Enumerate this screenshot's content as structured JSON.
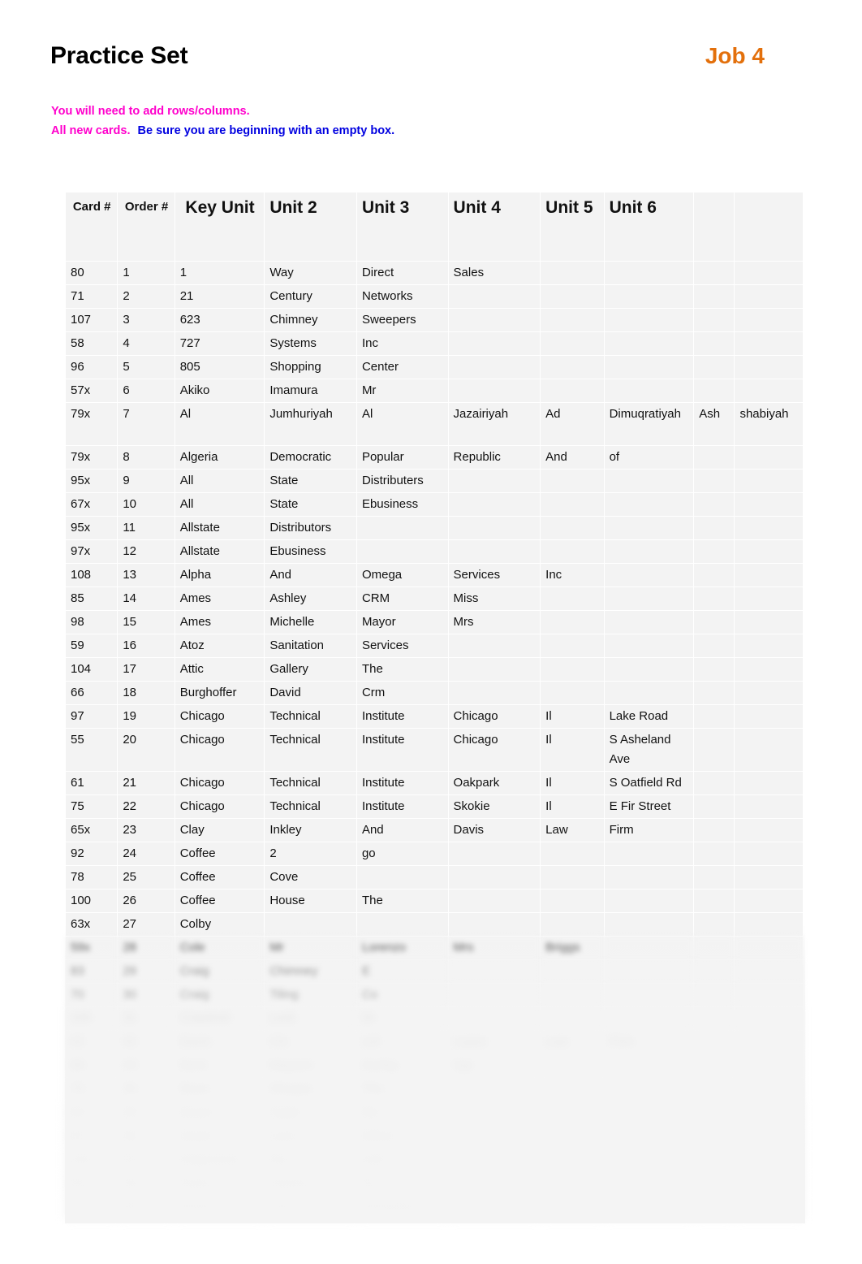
{
  "document": {
    "title": "Practice Set",
    "job_label": "Job 4"
  },
  "instructions": {
    "line1": "You will need to add rows/columns.",
    "line2_magenta": "All new cards.",
    "line2_blue": "Be sure you are beginning with an empty box."
  },
  "table": {
    "headers": [
      "Card #",
      "Order #",
      "Key Unit",
      "Unit 2",
      "Unit 3",
      "Unit 4",
      "Unit 5",
      "Unit 6",
      "",
      ""
    ],
    "rows": [
      {
        "card": "80",
        "order": "1",
        "key": "1",
        "u2": "Way",
        "u3": "Direct",
        "u4": "Sales",
        "u5": "",
        "u6": "",
        "x1": "",
        "x2": ""
      },
      {
        "card": "71",
        "order": "2",
        "key": "21",
        "u2": "Century",
        "u3": "Networks",
        "u4": "",
        "u5": "",
        "u6": "",
        "x1": "",
        "x2": ""
      },
      {
        "card": "107",
        "order": "3",
        "key": "623",
        "u2": "Chimney",
        "u3": "Sweepers",
        "u4": "",
        "u5": "",
        "u6": "",
        "x1": "",
        "x2": ""
      },
      {
        "card": "58",
        "order": "4",
        "key": "727",
        "u2": "Systems",
        "u3": "Inc",
        "u4": "",
        "u5": "",
        "u6": "",
        "x1": "",
        "x2": ""
      },
      {
        "card": "96",
        "order": "5",
        "key": "805",
        "u2": "Shopping",
        "u3": "Center",
        "u4": "",
        "u5": "",
        "u6": "",
        "x1": "",
        "x2": ""
      },
      {
        "card": "57x",
        "order": "6",
        "key": "Akiko",
        "u2": "Imamura",
        "u3": "Mr",
        "u4": "",
        "u5": "",
        "u6": "",
        "x1": "",
        "x2": ""
      },
      {
        "card": "79x",
        "order": "7",
        "key": "Al",
        "u2": "Jumhuriyah",
        "u3": "Al",
        "u4": "Jazairiyah",
        "u5": "Ad",
        "u6": "Dimuqratiyah",
        "x1": "Ash",
        "x2": "shabiyah",
        "tall": true
      },
      {
        "card": "79x",
        "order": "8",
        "key": "Algeria",
        "u2": "Democratic",
        "u3": "Popular",
        "u4": "Republic",
        "u5": "And",
        "u6": "of",
        "x1": "",
        "x2": ""
      },
      {
        "card": "95x",
        "order": "9",
        "key": "All",
        "u2": "State",
        "u3": "Distributers",
        "u4": "",
        "u5": "",
        "u6": "",
        "x1": "",
        "x2": ""
      },
      {
        "card": "67x",
        "order": "10",
        "key": "All",
        "u2": "State",
        "u3": "Ebusiness",
        "u4": "",
        "u5": "",
        "u6": "",
        "x1": "",
        "x2": ""
      },
      {
        "card": "95x",
        "order": "11",
        "key": "Allstate",
        "u2": "Distributors",
        "u3": "",
        "u4": "",
        "u5": "",
        "u6": "",
        "x1": "",
        "x2": ""
      },
      {
        "card": "97x",
        "order": "12",
        "key": "Allstate",
        "u2": "Ebusiness",
        "u3": "",
        "u4": "",
        "u5": "",
        "u6": "",
        "x1": "",
        "x2": ""
      },
      {
        "card": "108",
        "order": "13",
        "key": "Alpha",
        "u2": "And",
        "u3": "Omega",
        "u4": "Services",
        "u5": "Inc",
        "u6": "",
        "x1": "",
        "x2": ""
      },
      {
        "card": "85",
        "order": "14",
        "key": "Ames",
        "u2": "Ashley",
        "u3": "CRM",
        "u4": "Miss",
        "u5": "",
        "u6": "",
        "x1": "",
        "x2": ""
      },
      {
        "card": "98",
        "order": "15",
        "key": "Ames",
        "u2": "Michelle",
        "u3": "Mayor",
        "u4": "Mrs",
        "u5": "",
        "u6": "",
        "x1": "",
        "x2": ""
      },
      {
        "card": "59",
        "order": "16",
        "key": "Atoz",
        "u2": "Sanitation",
        "u3": "Services",
        "u4": "",
        "u5": "",
        "u6": "",
        "x1": "",
        "x2": ""
      },
      {
        "card": "104",
        "order": "17",
        "key": "Attic",
        "u2": "Gallery",
        "u3": "The",
        "u4": "",
        "u5": "",
        "u6": "",
        "x1": "",
        "x2": ""
      },
      {
        "card": "66",
        "order": "18",
        "key": "Burghoffer",
        "u2": "David",
        "u3": "Crm",
        "u4": "",
        "u5": "",
        "u6": "",
        "x1": "",
        "x2": ""
      },
      {
        "card": "97",
        "order": "19",
        "key": "Chicago",
        "u2": "Technical",
        "u3": "Institute",
        "u4": "Chicago",
        "u5": "Il",
        "u6": "Lake Road",
        "x1": "",
        "x2": ""
      },
      {
        "card": "55",
        "order": "20",
        "key": "Chicago",
        "u2": "Technical",
        "u3": "Institute",
        "u4": "Chicago",
        "u5": "Il",
        "u6": "S Asheland Ave",
        "x1": "",
        "x2": "",
        "u6_small": true
      },
      {
        "card": "61",
        "order": "21",
        "key": "Chicago",
        "u2": "Technical",
        "u3": "Institute",
        "u4": "Oakpark",
        "u5": "Il",
        "u6": "S Oatfield Rd",
        "x1": "",
        "x2": "",
        "u6_small": true
      },
      {
        "card": "75",
        "order": "22",
        "key": "Chicago",
        "u2": "Technical",
        "u3": "Institute",
        "u4": "Skokie",
        "u5": "Il",
        "u6": "E Fir Street",
        "x1": "",
        "x2": ""
      },
      {
        "card": "65x",
        "order": "23",
        "key": "Clay",
        "u2": "Inkley",
        "u3": "And",
        "u4": "Davis",
        "u5": "Law",
        "u6": "Firm",
        "x1": "",
        "x2": ""
      },
      {
        "card": "92",
        "order": "24",
        "key": "Coffee",
        "u2": "2",
        "u3": "go",
        "u4": "",
        "u5": "",
        "u6": "",
        "x1": "",
        "x2": ""
      },
      {
        "card": "78",
        "order": "25",
        "key": "Coffee",
        "u2": "Cove",
        "u3": "",
        "u4": "",
        "u5": "",
        "u6": "",
        "x1": "",
        "x2": ""
      },
      {
        "card": "100",
        "order": "26",
        "key": "Coffee",
        "u2": "House",
        "u3": "The",
        "u4": "",
        "u5": "",
        "u6": "",
        "x1": "",
        "x2": ""
      },
      {
        "card": "63x",
        "order": "27",
        "key": "Colby",
        "u2": "",
        "u3": "",
        "u4": "",
        "u5": "",
        "u6": "",
        "x1": "",
        "x2": ""
      }
    ],
    "obscured_rows": [
      {
        "card": "",
        "order": "",
        "key": "",
        "u2": "",
        "u3": "",
        "u4": "",
        "u5": "",
        "u6": "",
        "x1": "",
        "x2": ""
      },
      {
        "card": "",
        "order": "",
        "key": "",
        "u2": "",
        "u3": "",
        "u4": "",
        "u5": "",
        "u6": "",
        "x1": "",
        "x2": ""
      },
      {
        "card": "",
        "order": "",
        "key": "",
        "u2": "",
        "u3": "",
        "u4": "",
        "u5": "",
        "u6": "",
        "x1": "",
        "x2": ""
      },
      {
        "card": "",
        "order": "",
        "key": "",
        "u2": "",
        "u3": "",
        "u4": "",
        "u5": "",
        "u6": "",
        "x1": "",
        "x2": ""
      },
      {
        "card": "",
        "order": "",
        "key": "",
        "u2": "",
        "u3": "",
        "u4": "",
        "u5": "",
        "u6": "",
        "x1": "",
        "x2": ""
      },
      {
        "card": "",
        "order": "",
        "key": "",
        "u2": "",
        "u3": "",
        "u4": "",
        "u5": "",
        "u6": "",
        "x1": "",
        "x2": ""
      },
      {
        "card": "",
        "order": "",
        "key": "",
        "u2": "",
        "u3": "",
        "u4": "",
        "u5": "",
        "u6": "",
        "x1": "",
        "x2": ""
      },
      {
        "card": "",
        "order": "",
        "key": "",
        "u2": "",
        "u3": "",
        "u4": "",
        "u5": "",
        "u6": "",
        "x1": "",
        "x2": ""
      },
      {
        "card": "",
        "order": "",
        "key": "",
        "u2": "",
        "u3": "",
        "u4": "",
        "u5": "",
        "u6": "",
        "x1": "",
        "x2": ""
      },
      {
        "card": "",
        "order": "",
        "key": "",
        "u2": "",
        "u3": "",
        "u4": "",
        "u5": "",
        "u6": "",
        "x1": "",
        "x2": ""
      },
      {
        "card": "",
        "order": "",
        "key": "",
        "u2": "",
        "u3": "",
        "u4": "",
        "u5": "",
        "u6": "",
        "x1": "",
        "x2": ""
      },
      {
        "card": "",
        "order": "",
        "key": "",
        "u2": "",
        "u3": "",
        "u4": "",
        "u5": "",
        "u6": "",
        "x1": "",
        "x2": ""
      }
    ]
  }
}
